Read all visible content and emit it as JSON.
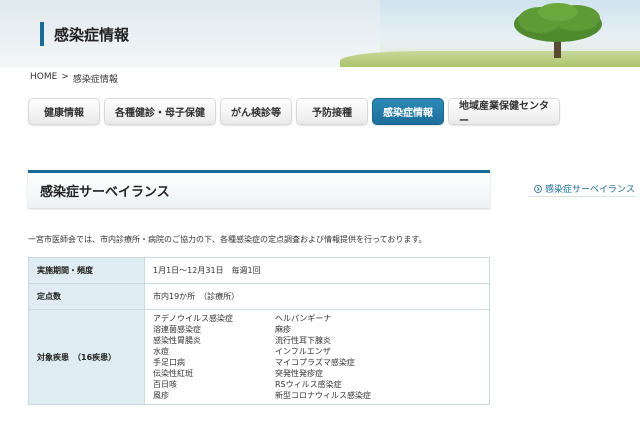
{
  "header": {
    "title": "感染症情報"
  },
  "breadcrumb": {
    "home": "HOME",
    "separator": ">",
    "current": "感染症情報"
  },
  "nav": {
    "items": [
      {
        "label": "健康情報"
      },
      {
        "label": "各種健診・母子保健"
      },
      {
        "label": "がん検診等"
      },
      {
        "label": "予防接種"
      },
      {
        "label": "感染症情報",
        "active": true
      },
      {
        "label": "地域産業保健センター"
      }
    ]
  },
  "section": {
    "title": "感染症サーベイランス"
  },
  "side": {
    "link_label": "感染症サーベイランス",
    "link_icon": "chevron-right-icon"
  },
  "intro": "一宮市医師会では、市内診療所・病院のご協力の下、各種感染症の定点調査および情報提供を行っております。",
  "table": {
    "rows": [
      {
        "header": "実施期間・頻度",
        "value": "1月1日～12月31日　毎週1回"
      },
      {
        "header": "定点数",
        "value": "市内19か所　（診療所）"
      },
      {
        "header": "対象疾患　（16疾患）",
        "col1": [
          "アデノウイルス感染症",
          "溶連菌感染症",
          "感染性胃腸炎",
          "水痘",
          "手足口病",
          "伝染性紅斑",
          "百日咳",
          "風疹"
        ],
        "col2": [
          "ヘルパンギーナ",
          "麻疹",
          "流行性耳下腺炎",
          "インフルエンザ",
          "マイコプラズマ感染症",
          "突発性発疹症",
          "RSウィルス感染症",
          "新型コロナウィルス感染症"
        ]
      }
    ]
  },
  "colors": {
    "accent": "#1a6a98",
    "table_header_bg": "#dfedf2",
    "active_tab": "#2e8ab8"
  }
}
